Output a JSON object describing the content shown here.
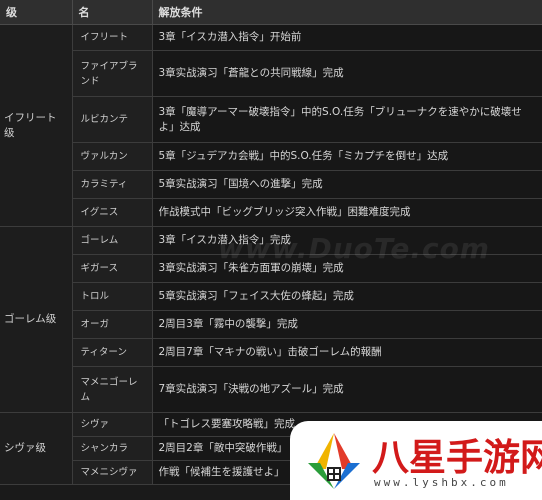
{
  "headers": {
    "group": "级",
    "name": "名",
    "condition": "解放条件"
  },
  "groups": {
    "ifrit": "イフリート级",
    "golem": "ゴーレム级",
    "shiva": "シヴァ级"
  },
  "rows": [
    {
      "name": "イフリート",
      "condition": "3章「イスカ潜入指令」开始前"
    },
    {
      "name": "ファイアブランド",
      "condition": "3章实战演习「蒼龍との共同戦線」完成"
    },
    {
      "name": "ルビカンテ",
      "condition": "3章「魔導アーマー破壊指令」中的S.O.任务「ブリューナクを速やかに破壊せよ」达成"
    },
    {
      "name": "ヴァルカン",
      "condition": "5章「ジュデアカ会戦」中的S.O.任务「ミカプチを倒せ」达成"
    },
    {
      "name": "カラミティ",
      "condition": "5章实战演习「国境への進撃」完成"
    },
    {
      "name": "イグニス",
      "condition": "作战模式中「ビッグブリッジ突入作戦」困難难度完成"
    },
    {
      "name": "ゴーレム",
      "condition": "3章「イスカ潜入指令」完成"
    },
    {
      "name": "ギガース",
      "condition": "3章实战演习「朱雀方面軍の崩壊」完成"
    },
    {
      "name": "トロル",
      "condition": "5章实战演习「フェイス大佐の蜂起」完成"
    },
    {
      "name": "オーガ",
      "condition": "2周目3章「霧中の襲撃」完成"
    },
    {
      "name": "ティターン",
      "condition": "2周目7章「マキナの戦い」击破ゴーレム的報酬"
    },
    {
      "name": "マメニゴーレム",
      "condition": "7章实战演习「決戦の地アズール」完成"
    },
    {
      "name": "シヴァ",
      "condition": "「トゴレス要塞攻略戦」完成"
    },
    {
      "name": "シャンカラ",
      "condition": "2周目2章「敵中突破作戦」"
    },
    {
      "name": "マメニシヴァ",
      "condition": "作戦「候補生を援護せよ」"
    }
  ],
  "watermark": "www.DuoTe.com",
  "logo": {
    "title": "八星手游网",
    "url": "www.lyshbx.com"
  }
}
